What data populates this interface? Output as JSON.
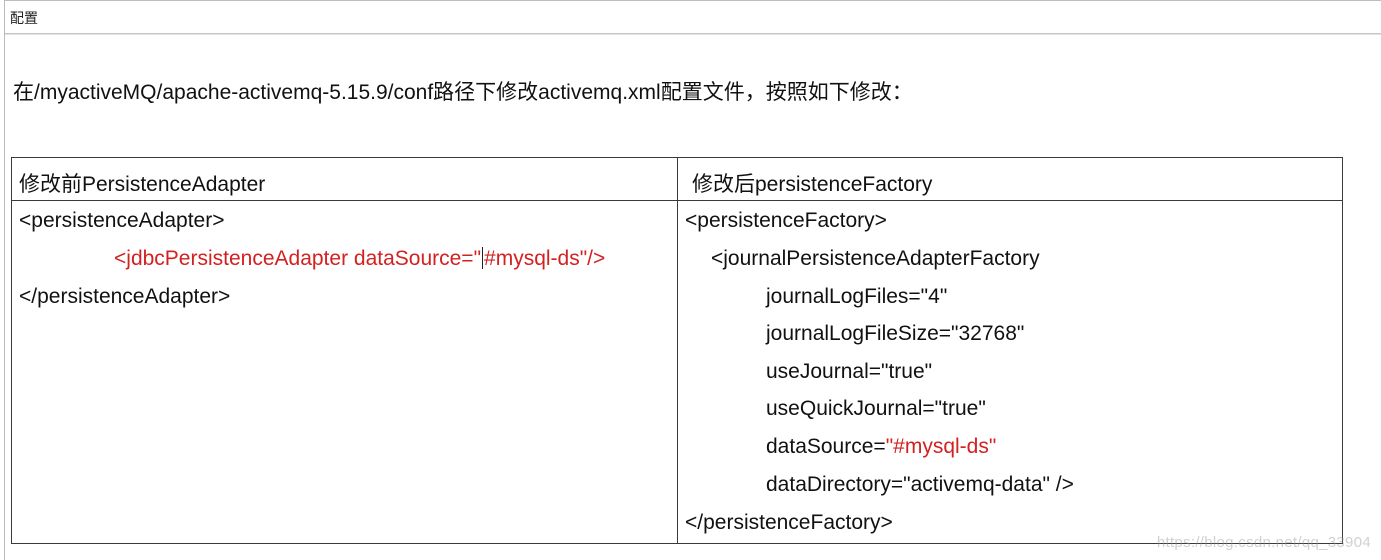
{
  "document": {
    "title": "配置",
    "instruction": "在/myactiveMQ/apache-activemq-5.15.9/conf路径下修改activemq.xml配置文件，按照如下修改："
  },
  "table": {
    "before_header": "修改前PersistenceAdapter",
    "after_header": "修改后persistenceFactory",
    "before_code": {
      "open": "<persistenceAdapter>",
      "jdbc_line_a": "<j",
      "jdbc_line_b": "dbcPersistenceAdapter dataSource=\"",
      "jdbc_line_c": "#mysql-ds\"/>",
      "close": "</persistenceAdapter>"
    },
    "after_code": {
      "open": "<persistenceFactory>",
      "factory_open": "<journalPersistenceAdapterFactory",
      "attr_log_files": "journalLogFiles=\"4\"",
      "attr_log_file_size": "journalLogFileSize=\"32768\"",
      "attr_use_journal": "useJournal=\"true\"",
      "attr_use_quick_journal": "useQuickJournal=\"true\"",
      "attr_datasource_key": "dataSource=",
      "attr_datasource_value": "\"#mysql-ds\"",
      "attr_data_directory": "dataDirectory=\"activemq-data\" />",
      "close": "</persistenceFactory>"
    }
  },
  "watermark": "https://blog.csdn.net/qq_33904",
  "colors": {
    "highlight_red": "#d42020",
    "text": "#111111",
    "border": "#3a3a3a"
  }
}
